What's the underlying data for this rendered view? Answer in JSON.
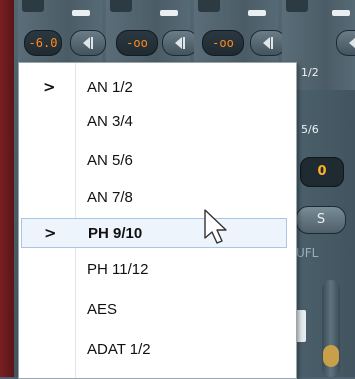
{
  "mixer": {
    "level_values": [
      "-6.0",
      "-oo",
      "-oo"
    ],
    "channel_labels": [
      "1/2",
      "5/6"
    ],
    "value_box": "0",
    "solo_label": "S",
    "ufl_label": "UFL"
  },
  "menu": {
    "items": [
      {
        "label": "AN 1/2",
        "checked": true
      },
      {
        "label": "AN 3/4",
        "checked": false
      },
      {
        "label": "AN 5/6",
        "checked": false
      },
      {
        "label": "AN 7/8",
        "checked": false
      },
      {
        "label": "PH 9/10",
        "checked": true
      },
      {
        "label": "PH 11/12",
        "checked": false
      },
      {
        "label": "AES",
        "checked": false
      },
      {
        "label": "ADAT 1/2",
        "checked": false
      }
    ],
    "check_glyph": ">"
  },
  "colors": {
    "level_text": "#ff8a1e",
    "value_text": "#ffb12a",
    "hover_bg": "#eef4fb",
    "hover_border": "#a9c6e6"
  },
  "icons": {
    "cursor": "mouse-pointer-icon",
    "pan": "pan-left-arrow-icon"
  }
}
